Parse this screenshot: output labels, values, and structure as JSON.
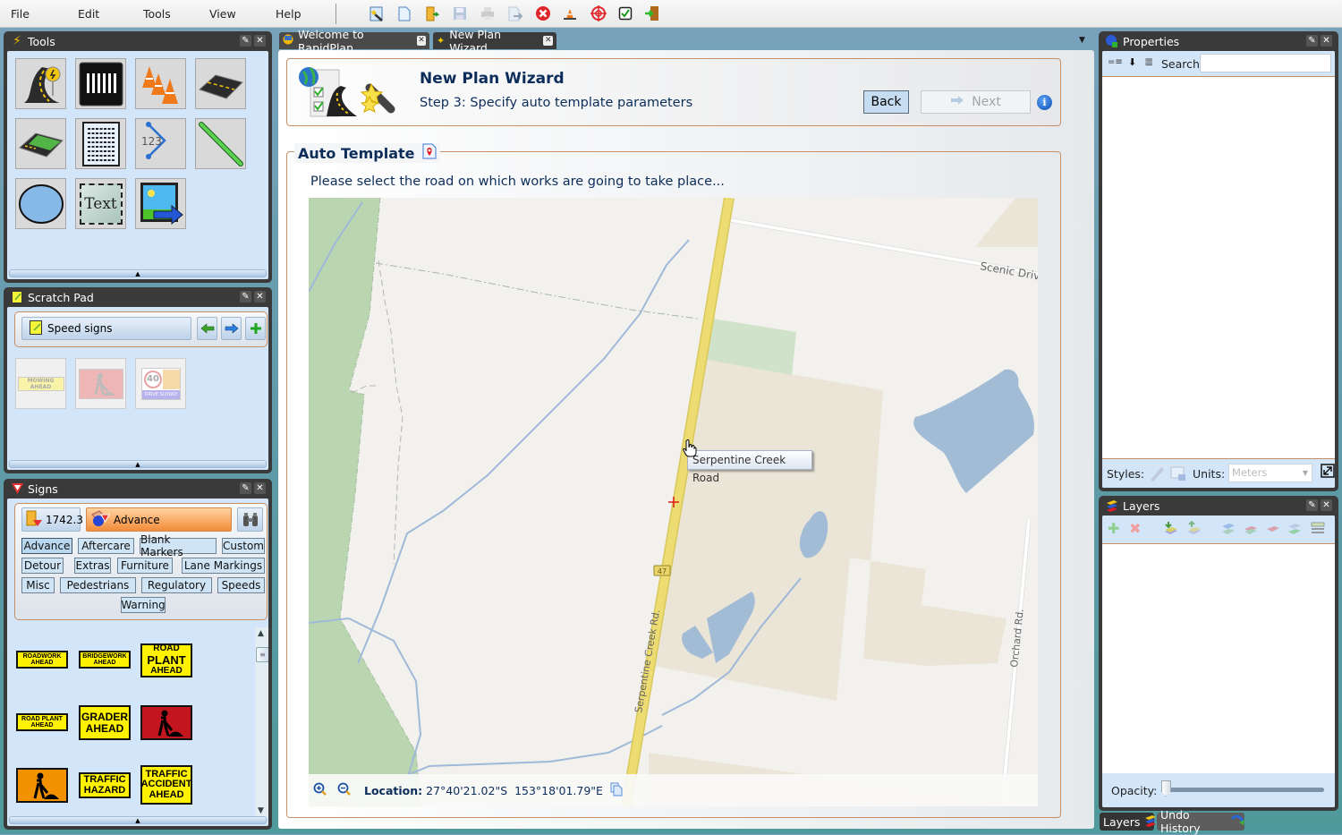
{
  "menu": {
    "items": [
      "File",
      "Edit",
      "Tools",
      "View",
      "Help"
    ]
  },
  "toolbar": {
    "icons": [
      "new-plan-wizard-icon",
      "new-document-icon",
      "open-folder-icon",
      "save-icon",
      "print-icon",
      "export-icon",
      "close-red-icon",
      "traffic-cones-icon",
      "target-icon",
      "checkbox-icon",
      "exit-door-icon"
    ]
  },
  "panels": {
    "tools": {
      "title": "Tools",
      "items": [
        "road-sign-tool",
        "pedestrian-crossing-tool",
        "traffic-cones-tool",
        "road-segment-tool",
        "road-area-tool",
        "text-block-tool",
        "measure-tool",
        "line-tool",
        "ellipse-tool",
        "text-tool",
        "image-tool"
      ],
      "text_tool_label": "Text",
      "measure_label": "123"
    },
    "scratch": {
      "title": "Scratch Pad",
      "selector": "Speed signs",
      "items": [
        {
          "name": "mowing-ahead",
          "text": "MOWING AHEAD"
        },
        {
          "name": "roadworker-red",
          "text": ""
        },
        {
          "name": "speed-40-drive-slowly",
          "text": "40",
          "sub": "DRIVE SLOWLY"
        }
      ]
    },
    "signs": {
      "title": "Signs",
      "library_value": "1742.3",
      "category": "Advance",
      "categories": [
        "Advance",
        "Aftercare",
        "Blank Markers",
        "Custom",
        "Detour",
        "Extras",
        "Furniture",
        "Lane Markings",
        "Misc",
        "Pedestrians",
        "Regulatory",
        "Speeds",
        "Warning"
      ],
      "items": [
        {
          "l1": "ROADWORK",
          "l2": "AHEAD",
          "l3": ""
        },
        {
          "l1": "BRIDGEWORK",
          "l2": "AHEAD",
          "l3": ""
        },
        {
          "l1": "ROAD",
          "l2": "PLANT",
          "l3": "AHEAD"
        },
        {
          "l1": "ROAD PLANT",
          "l2": "AHEAD",
          "l3": ""
        },
        {
          "l1": "GRADER",
          "l2": "AHEAD",
          "l3": ""
        },
        {
          "l1": "",
          "l2": "",
          "l3": ""
        },
        {
          "l1": "",
          "l2": "",
          "l3": ""
        },
        {
          "l1": "TRAFFIC",
          "l2": "HAZARD",
          "l3": ""
        },
        {
          "l1": "TRAFFIC",
          "l2": "ACCIDENT",
          "l3": "AHEAD"
        }
      ]
    },
    "properties": {
      "title": "Properties",
      "search_label": "Search:",
      "search_value": "",
      "styles_label": "Styles:",
      "units_label": "Units:",
      "units_value": "Meters"
    },
    "layers": {
      "title": "Layers",
      "opacity_label": "Opacity:",
      "opacity": 0
    }
  },
  "tabs": [
    {
      "label": "Welcome to RapidPlan",
      "active": false
    },
    {
      "label": "New Plan Wizard",
      "active": true
    }
  ],
  "bottom_tabs": [
    {
      "label": "Layers",
      "active": true
    },
    {
      "label": "Undo History",
      "active": false
    }
  ],
  "wizard": {
    "title": "New Plan Wizard",
    "step": "Step 3: Specify auto template parameters",
    "back_label": "Back",
    "next_label": "Next",
    "next_enabled": false,
    "section_title": "Auto Template",
    "instruction": "Please select the road on which works are going to take place..."
  },
  "map": {
    "tooltip": "Serpentine Creek Road",
    "labels": {
      "scenic": "Scenic Drive",
      "serpentine": "Serpentine Creek Rd.",
      "orchard": "Orchard Rd.",
      "route": "47"
    },
    "location_label": "Location:",
    "location_value": "27°40'21.02\"S  153°18'01.79\"E"
  },
  "colors": {
    "accent": "#0c2d5a",
    "panel_bg": "#d3e5f8",
    "road": "#e8d468",
    "water": "#a3bcd6",
    "park": "#b9d6b0",
    "farm": "#ebe5d8"
  }
}
